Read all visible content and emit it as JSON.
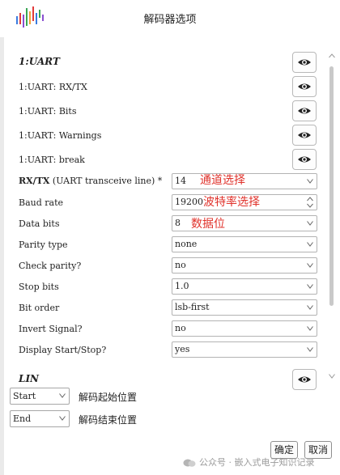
{
  "window": {
    "title": "解码器选项"
  },
  "sections": [
    {
      "header": "1:UART",
      "show_icon": "eye-icon"
    },
    {
      "header": "LIN",
      "show_icon": "eye-icon"
    }
  ],
  "annotation_rows": [
    {
      "label": "1:UART: RX/TX",
      "icon": "eye-icon"
    },
    {
      "label": "1:UART: Bits",
      "icon": "eye-icon"
    },
    {
      "label": "1:UART: Warnings",
      "icon": "eye-icon"
    },
    {
      "label": "1:UART: break",
      "icon": "eye-icon"
    }
  ],
  "options": [
    {
      "label_bold": "RX/TX",
      "label_rest": " (UART transceive line) *",
      "value": "14",
      "control": "dropdown"
    },
    {
      "label": "Baud rate",
      "value": "19200",
      "control": "spinbox"
    },
    {
      "label": "Data bits",
      "value": "8",
      "control": "dropdown"
    },
    {
      "label": "Parity type",
      "value": "none",
      "control": "dropdown"
    },
    {
      "label": "Check parity?",
      "value": "no",
      "control": "dropdown"
    },
    {
      "label": "Stop bits",
      "value": "1.0",
      "control": "dropdown"
    },
    {
      "label": "Bit order",
      "value": "lsb-first",
      "control": "dropdown"
    },
    {
      "label": "Invert Signal?",
      "value": "no",
      "control": "dropdown"
    },
    {
      "label": "Display Start/Stop?",
      "value": "yes",
      "control": "dropdown"
    }
  ],
  "callouts": [
    "通道选择",
    "波特率选择",
    "数据位"
  ],
  "bottom": {
    "start_select": "Start",
    "start_label": "解码起始位置",
    "end_select": "End",
    "end_label": "解码结束位置"
  },
  "buttons": {
    "ok": "确定",
    "cancel": "取消"
  },
  "watermark": "公众号 · 嵌入式电子知识记录",
  "colors": {
    "callout": "#e0322b",
    "logo_bars": [
      "#e23b3b",
      "#f2a13a",
      "#3aa655",
      "#3b7be0",
      "#8a4fd1"
    ]
  }
}
